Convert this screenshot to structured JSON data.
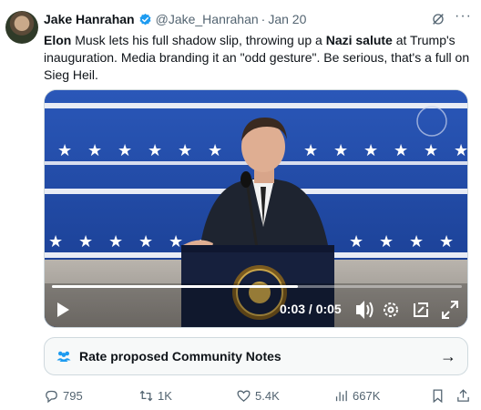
{
  "tweet": {
    "author_name": "Jake Hanrahan",
    "handle": "@Jake_Hanrahan",
    "separator": "·",
    "date": "Jan 20",
    "text": {
      "p1": "Elon",
      "p2": " Musk lets his full shadow slip, throwing up a ",
      "p3": "Nazi salute",
      "p4": " at Trump's inauguration. Media branding it an \"odd gesture\". Be serious, that's a full on Sieg Heil."
    }
  },
  "video": {
    "time": "0:03 / 0:05",
    "progress": 0.6
  },
  "community_notes": {
    "label": "Rate proposed Community Notes",
    "arrow": "→"
  },
  "actions": {
    "replies": "795",
    "reposts": "1K",
    "likes": "5.4K",
    "views": "667K"
  },
  "colors": {
    "verified": "#1d9bf0",
    "stage_blue": "#1d3c8f",
    "text_secondary": "#536471"
  },
  "icons": [
    "verified-badge-icon",
    "grok-icon",
    "more-icon",
    "play-icon",
    "volume-icon",
    "settings-icon",
    "pip-icon",
    "fullscreen-icon",
    "community-notes-icon",
    "arrow-right-icon",
    "reply-icon",
    "retweet-icon",
    "like-icon",
    "views-icon",
    "bookmark-icon",
    "share-icon"
  ]
}
